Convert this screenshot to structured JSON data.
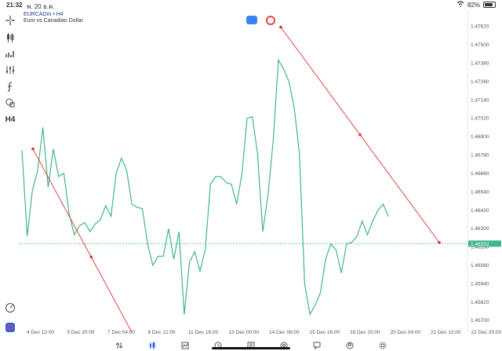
{
  "status": {
    "time": "21:32",
    "date": "พ. 20 ธ.ค.",
    "battery": "82%"
  },
  "symbol": {
    "name": "EURCADm • H4",
    "description": "Euro vs Canadian Dollar",
    "timeframe_button": "H4"
  },
  "chart_data": {
    "type": "line",
    "x": [
      "4 Dec 12:00",
      "5 Dec 20:00",
      "7 Dec 04:00",
      "8 Dec 12:00",
      "11 Dec 16:00",
      "13 Dec 00:00",
      "14 Dec 08:00",
      "15 Dec 16:00",
      "18 Dec 20:00",
      "20 Dec 04:00",
      "21 Dec 12:00",
      "22 Dec 20:00"
    ],
    "y_ticks": [
      "1.47620",
      "1.47500",
      "1.47380",
      "1.47260",
      "1.47140",
      "1.47020",
      "1.46900",
      "1.46780",
      "1.46660",
      "1.46540",
      "1.46420",
      "1.46300",
      "1.46180",
      "1.46060",
      "1.45940",
      "1.45820",
      "1.45700"
    ],
    "current_price": "1.46202",
    "ylim": [
      1.4565,
      1.477
    ],
    "series": [
      {
        "color": "#3fb68b",
        "values": [
          1.4681,
          1.4625,
          1.4655,
          1.4668,
          1.4696,
          1.4657,
          1.4682,
          1.4664,
          1.4666,
          1.464,
          1.4626,
          1.4632,
          1.4634,
          1.4628,
          1.4633,
          1.4636,
          1.4645,
          1.4638,
          1.4666,
          1.4676,
          1.4668,
          1.4646,
          1.4644,
          1.4643,
          1.462,
          1.4606,
          1.4612,
          1.4612,
          1.463,
          1.461,
          1.4628,
          1.4574,
          1.4608,
          1.4615,
          1.4602,
          1.4616,
          1.4659,
          1.4664,
          1.4664,
          1.466,
          1.4659,
          1.4646,
          1.4665,
          1.4702,
          1.4703,
          1.4679,
          1.4628,
          1.4652,
          1.4688,
          1.474,
          1.4734,
          1.4726,
          1.4709,
          1.4679,
          1.4594,
          1.4574,
          1.458,
          1.4588,
          1.461,
          1.462,
          1.4616,
          1.4601,
          1.462,
          1.4621,
          1.4625,
          1.4635,
          1.4626,
          1.4635,
          1.4642,
          1.4646,
          1.4638
        ]
      }
    ],
    "trend_lines": [
      {
        "color": "#e03030",
        "points": [
          [
            "4 Dec 12:00",
            1.4682
          ],
          [
            "8 Dec 12:00",
            1.4541
          ]
        ]
      },
      {
        "color": "#e03030",
        "points": [
          [
            "14 Dec 08:00",
            1.47615
          ],
          [
            "21 Dec 12:00",
            1.4621
          ]
        ]
      }
    ]
  },
  "nav": {
    "items": [
      {
        "label": "ราคา",
        "icon": "swap-icon"
      },
      {
        "label": "กราฟ",
        "icon": "candles-icon"
      },
      {
        "label": "การซื้อขาย",
        "icon": "trend-icon"
      },
      {
        "label": "ประวัติ",
        "icon": "history-icon"
      },
      {
        "label": "ข่าว",
        "icon": "news-icon"
      },
      {
        "label": "กล่องจดหมาย",
        "icon": "at-icon"
      },
      {
        "label": "แชท",
        "icon": "chat-icon"
      },
      {
        "label": "บัญชี",
        "icon": "account-icon"
      },
      {
        "label": "การตั้งค่า",
        "icon": "settings-icon"
      }
    ],
    "active": 1
  },
  "colors": {
    "accent": "#2563eb",
    "series": "#3fb68b",
    "trend": "#e03030"
  }
}
